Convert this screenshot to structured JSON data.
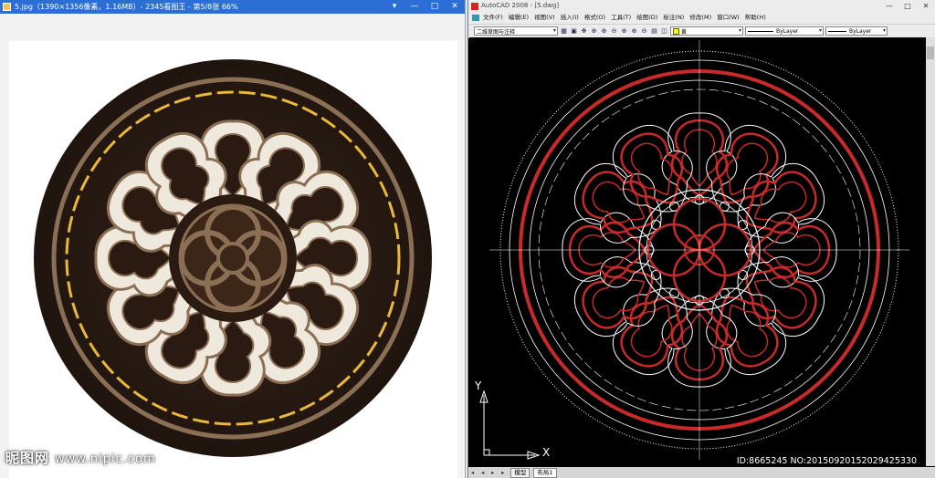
{
  "viewer": {
    "title": "5.jpg（1390×1356像素，1.16MB）- 2345看图王 - 第5/8张 66%",
    "buttons": [
      "▾",
      "—",
      "□",
      "✕"
    ]
  },
  "cad": {
    "title": "AutoCAD 2008 - [5.dwg]",
    "buttons": [
      "—",
      "□",
      "✕"
    ],
    "menu": [
      "文件(F)",
      "编辑(E)",
      "视图(V)",
      "插入(I)",
      "格式(O)",
      "工具(T)",
      "绘图(D)",
      "标注(N)",
      "修改(M)",
      "窗口(W)",
      "帮助(H)"
    ],
    "workspace": "二维草图与注释",
    "layer_color": "黄",
    "linetype": "ByLayer",
    "lineweight": "ByLayer",
    "ucs_x": "X",
    "ucs_y": "Y",
    "tabs": [
      "模型",
      "布局1"
    ],
    "colors": {
      "red": "#c82a2a",
      "white": "#ffffff",
      "bg": "#000000"
    }
  },
  "watermark": {
    "brand": "昵图网",
    "url": "www.nipic.com",
    "id_text": "ID:8665245 NO:20150920152029425330"
  },
  "medallion_colors": {
    "dark": "#2a1a12",
    "brown": "#8a6f55",
    "cream": "#efe8dc",
    "gold": "#e9b83a"
  }
}
